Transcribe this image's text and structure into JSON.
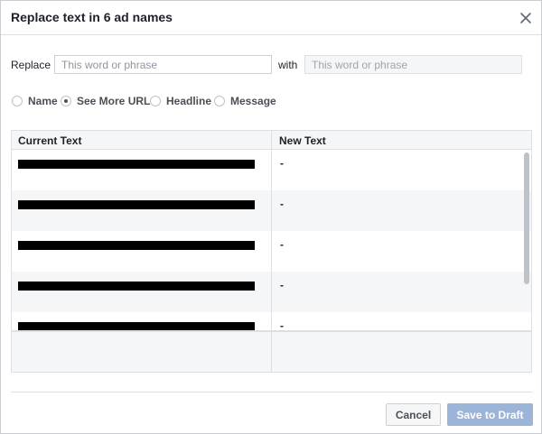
{
  "dialog": {
    "title": "Replace text in 6 ad names",
    "close_icon": "close-icon"
  },
  "replace": {
    "label": "Replace",
    "placeholder": "This word or phrase",
    "value": "",
    "with_label": "with",
    "with_placeholder": "This word or phrase",
    "with_value": ""
  },
  "options": {
    "selected": "See More URL",
    "items": [
      {
        "label": "Name",
        "checked": false
      },
      {
        "label": "See More URL",
        "checked": true
      },
      {
        "label": "Headline",
        "checked": false
      },
      {
        "label": "Message",
        "checked": false
      }
    ]
  },
  "table": {
    "headers": {
      "current": "Current Text",
      "new": "New Text"
    },
    "rows": [
      {
        "current": "[redacted]",
        "new": "-"
      },
      {
        "current": "[redacted]",
        "new": "-"
      },
      {
        "current": "[redacted]",
        "new": "-"
      },
      {
        "current": "[redacted]",
        "new": "-"
      },
      {
        "current": "[redacted]",
        "new": "-"
      }
    ]
  },
  "footer": {
    "cancel_label": "Cancel",
    "save_label": "Save to Draft"
  },
  "colors": {
    "border": "#dddfe2",
    "alt_row": "#f5f6f7",
    "save_disabled": "#9cb4d8",
    "text": "#1d2129"
  }
}
